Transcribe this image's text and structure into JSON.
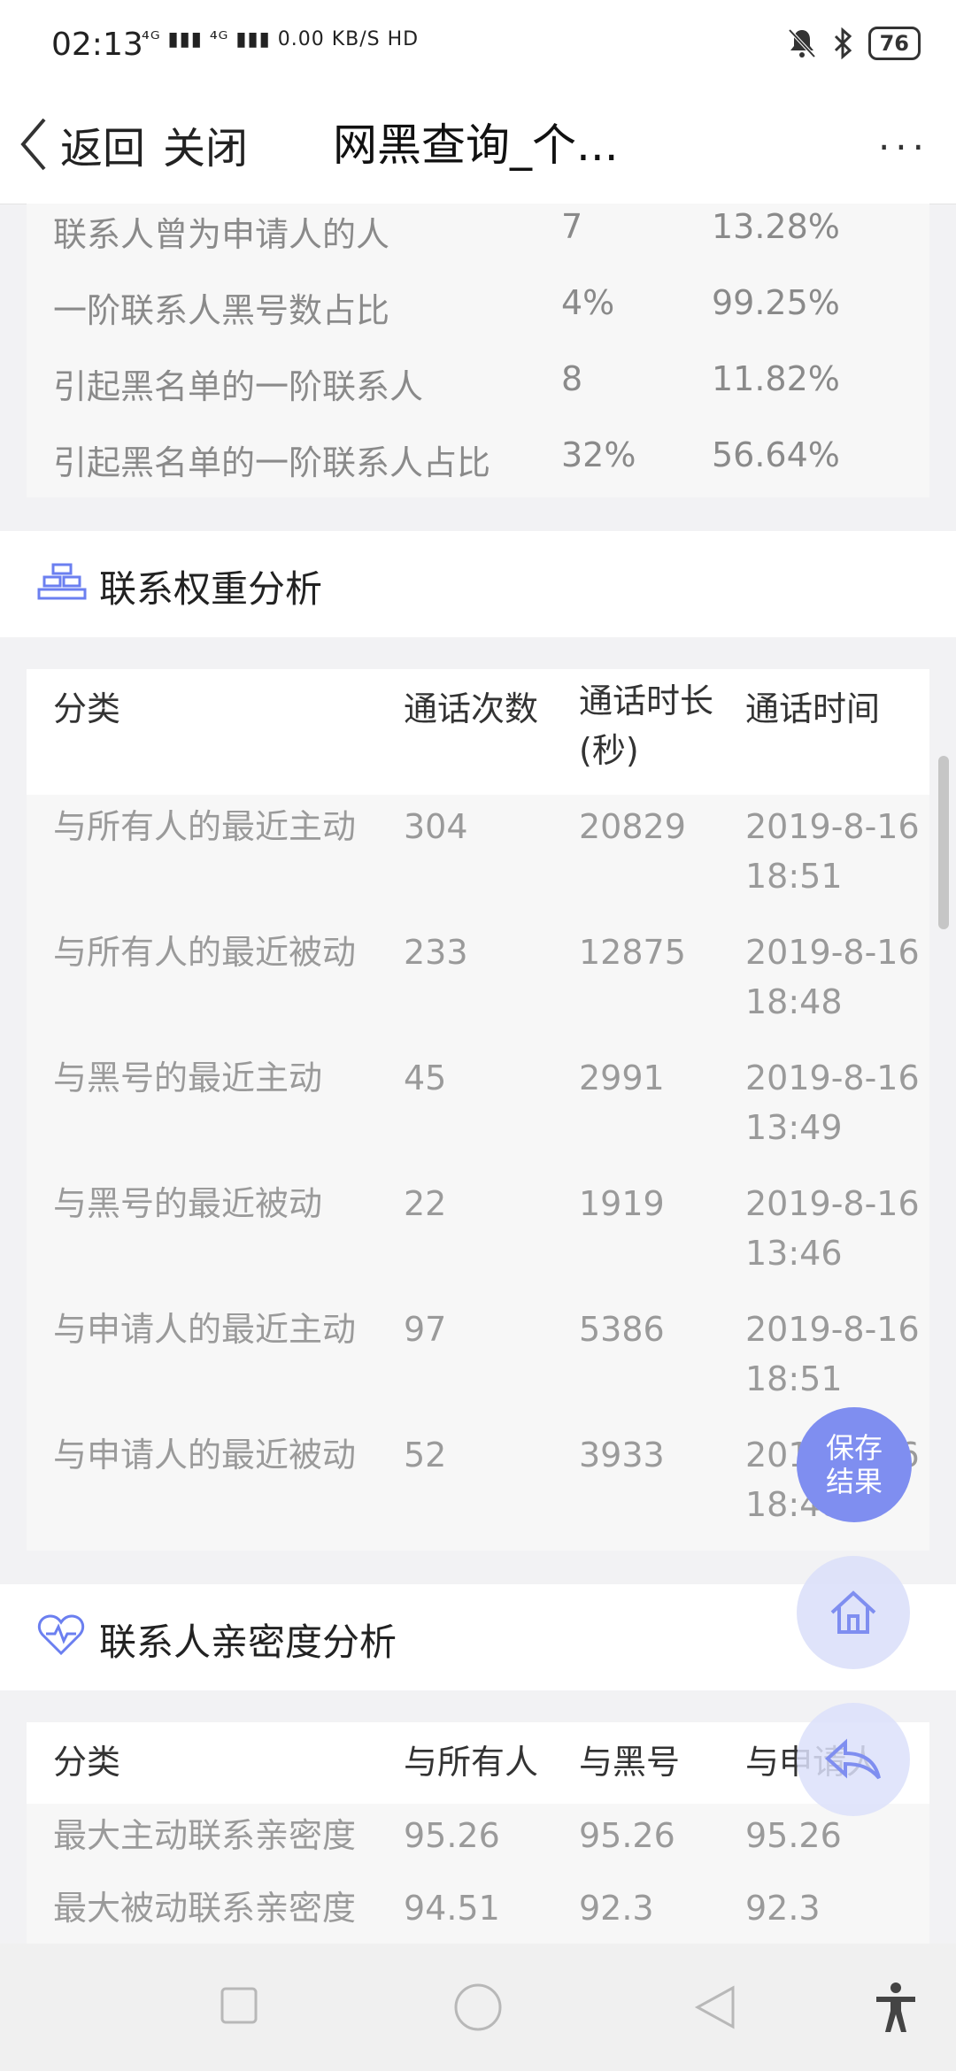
{
  "status": {
    "time": "02:13",
    "network": "⁴ᴳ ▮▮▮ ⁴ᴳ ▮▮▮ 0.00 KB/S HD",
    "battery": "76"
  },
  "nav": {
    "back": "返回",
    "close": "关闭",
    "title": "网黑查询_个...",
    "more": "···"
  },
  "top_rows": [
    {
      "label": "联系人曾为申请人的人",
      "v1": "7",
      "v2": "13.28%"
    },
    {
      "label": "一阶联系人黑号数占比",
      "v1": "4%",
      "v2": "99.25%"
    },
    {
      "label": "引起黑名单的一阶联系人",
      "v1": "8",
      "v2": "11.82%"
    },
    {
      "label": "引起黑名单的一阶联系人占比",
      "v1": "32%",
      "v2": "56.64%"
    }
  ],
  "weight": {
    "title": "联系权重分析",
    "headers": [
      "分类",
      "通话次数",
      "通话时长(秒)",
      "通话时间"
    ],
    "rows": [
      {
        "c": "与所有人的最近主动",
        "n": "304",
        "d": "20829",
        "t1": "2019-8-16",
        "t2": "18:51"
      },
      {
        "c": "与所有人的最近被动",
        "n": "233",
        "d": "12875",
        "t1": "2019-8-16",
        "t2": "18:48"
      },
      {
        "c": "与黑号的最近主动",
        "n": "45",
        "d": "2991",
        "t1": "2019-8-16",
        "t2": "13:49"
      },
      {
        "c": "与黑号的最近被动",
        "n": "22",
        "d": "1919",
        "t1": "2019-8-16",
        "t2": "13:46"
      },
      {
        "c": "与申请人的最近主动",
        "n": "97",
        "d": "5386",
        "t1": "2019-8-16",
        "t2": "18:51"
      },
      {
        "c": "与申请人的最近被动",
        "n": "52",
        "d": "3933",
        "t1": "2019-8-16",
        "t2": "18:48"
      }
    ]
  },
  "intimacy": {
    "title": "联系人亲密度分析",
    "headers": [
      "分类",
      "与所有人",
      "与黑号",
      "与申请人"
    ],
    "rows": [
      {
        "c": "最大主动联系亲密度",
        "a": "95.26",
        "b": "95.26",
        "s": "95.26"
      },
      {
        "c": "最大被动联系亲密度",
        "a": "94.51",
        "b": "92.3",
        "s": "92.3"
      }
    ]
  },
  "fab": {
    "save_l1": "保存",
    "save_l2": "结果"
  }
}
